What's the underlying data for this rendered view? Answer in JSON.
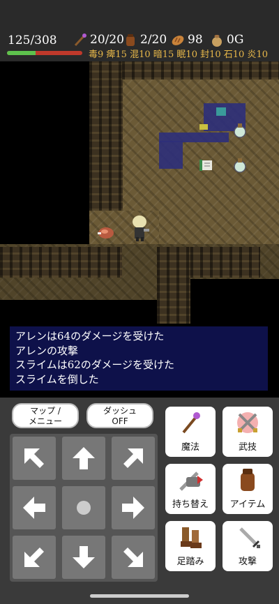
{
  "hud": {
    "hp": "125/308",
    "hp_fraction": 0.38,
    "stats": [
      {
        "icon": "staff-icon",
        "value": "20/20"
      },
      {
        "icon": "bag-icon",
        "value": "2/20"
      },
      {
        "icon": "bread-icon",
        "value": "98"
      },
      {
        "icon": "money-bag-icon",
        "value": "0G"
      }
    ],
    "resistances": "毒9 痺15 混10 暗15 眠10 封10 石10 炎10"
  },
  "messages": [
    "アレンは64のダメージを受けた",
    "アレンの攻撃",
    "スライムは62のダメージを受けた",
    "スライムを倒した"
  ],
  "controls": {
    "map_menu": "マップ/\nメニュー",
    "map_menu_l1": "マップ /",
    "map_menu_l2": "メニュー",
    "dash_l1": "ダッシュ",
    "dash_l2": "OFF",
    "actions": [
      {
        "icon": "magic-staff-icon",
        "label": "魔法"
      },
      {
        "icon": "weapon-skill-icon",
        "label": "武技"
      },
      {
        "icon": "swap-weapon-icon",
        "label": "持ち替え"
      },
      {
        "icon": "item-bag-icon",
        "label": "アイテム"
      },
      {
        "icon": "step-boots-icon",
        "label": "足踏み"
      },
      {
        "icon": "attack-sword-icon",
        "label": "攻撃"
      }
    ]
  },
  "colors": {
    "hp_green": "#5ec24d",
    "hp_red": "#c0392b",
    "resist_text": "#e8b84a",
    "message_bg": "#0f1250"
  }
}
